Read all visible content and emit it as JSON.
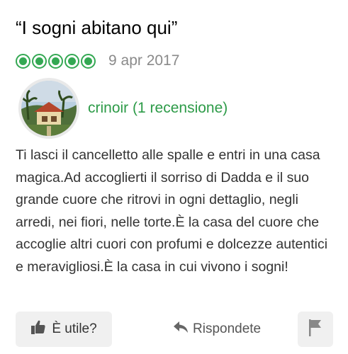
{
  "review": {
    "title": "“I sogni abitano qui”",
    "rating": 5,
    "rating_max": 5,
    "rating_color": "#34a853",
    "date": "9 apr 2017",
    "reviewer": {
      "name": "crinoir",
      "reviews_count": "(1 recensione)",
      "name_color": "#2d9b48"
    },
    "text": "Ti lasci il cancelletto alle spalle e entri in una casa magica.Ad accoglierti il sorriso di Dadda e il suo grande cuore che ritrovi in ogni dettaglio, negli arredi, nei fiori, nelle torte.È la casa del cuore che accoglie altri cuori con profumi e dolcezze autentici e meravigliosi.È la casa in cui vivono i sogni!"
  },
  "actions": {
    "useful_label": "È utile?",
    "useful_icon": "thumbs-up-icon",
    "reply_label": "Rispondete",
    "reply_icon": "reply-arrow-icon",
    "flag_icon": "flag-icon"
  }
}
